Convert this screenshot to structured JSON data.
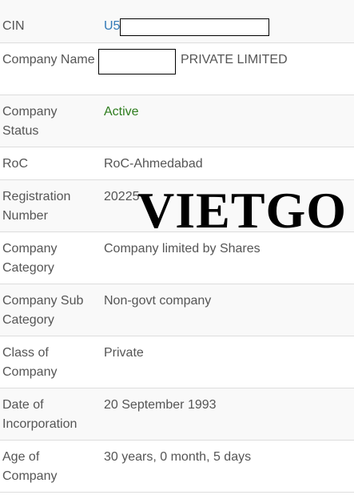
{
  "rows": [
    {
      "label": "CIN",
      "value": "U5"
    },
    {
      "label": "Company Name",
      "value": "PRIVATE LIMITED"
    },
    {
      "label": "Company Status",
      "value": "Active"
    },
    {
      "label": "RoC",
      "value": "RoC-Ahmedabad"
    },
    {
      "label": "Registration Number",
      "value": "20225"
    },
    {
      "label": "Company Category",
      "value": "Company limited by Shares"
    },
    {
      "label": "Company Sub Category",
      "value": "Non-govt company"
    },
    {
      "label": "Class of Company",
      "value": "Private"
    },
    {
      "label": "Date of Incorporation",
      "value": "20 September 1993"
    },
    {
      "label": "Age of Company",
      "value": "30 years, 0 month, 5 days"
    }
  ],
  "watermark": "VIETGO",
  "colors": {
    "link": "#337ab7",
    "active": "#2e7d1e",
    "text": "#555555",
    "stripe": "#f9f9f9",
    "border": "#dddddd"
  }
}
